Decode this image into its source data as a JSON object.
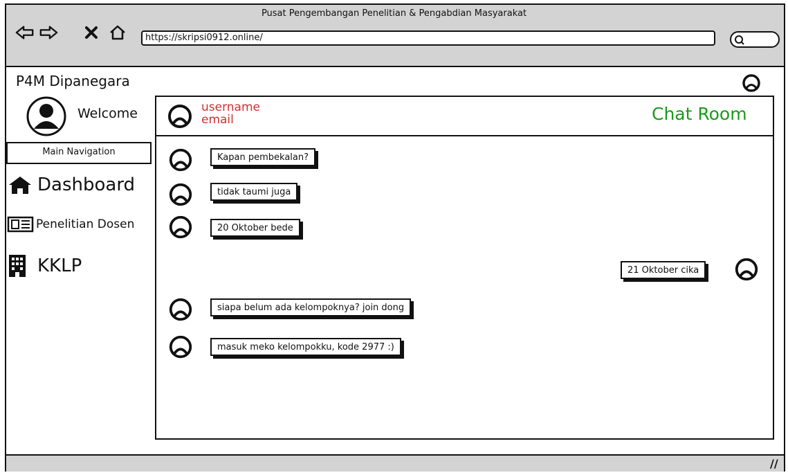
{
  "window": {
    "title": "Pusat Pengembangan Penelitian & Pengabdian Masyarakat"
  },
  "browser": {
    "url": "https://skripsi0912.online/",
    "back_icon": "back-arrow-icon",
    "forward_icon": "forward-arrow-icon",
    "stop_icon": "stop-x-icon",
    "home_icon": "home-icon",
    "search_icon": "search-icon"
  },
  "app": {
    "brand": "P4M Dipanegara"
  },
  "sidebar": {
    "welcome": "Welcome",
    "nav_title": "Main Navigation",
    "items": [
      {
        "label": "Dashboard",
        "icon": "home-icon"
      },
      {
        "label": "Penelitian Dosen",
        "icon": "newspaper-icon"
      },
      {
        "label": "KKLP",
        "icon": "building-icon"
      }
    ]
  },
  "chat": {
    "username": "username",
    "email": "email",
    "title": "Chat Room",
    "messages": [
      {
        "text": "Kapan pembekalan?",
        "side": "left"
      },
      {
        "text": "tidak taumi juga",
        "side": "left"
      },
      {
        "text": "20 Oktober bede",
        "side": "left"
      },
      {
        "text": "21 Oktober cika",
        "side": "right"
      },
      {
        "text": "siapa belum ada kelompoknya? join dong",
        "side": "left"
      },
      {
        "text": "masuk meko kelompokku, kode 2977 :)",
        "side": "left"
      }
    ]
  },
  "colors": {
    "username": "#d03030",
    "title": "#1a9a1a",
    "chrome": "#d3d3d3"
  }
}
